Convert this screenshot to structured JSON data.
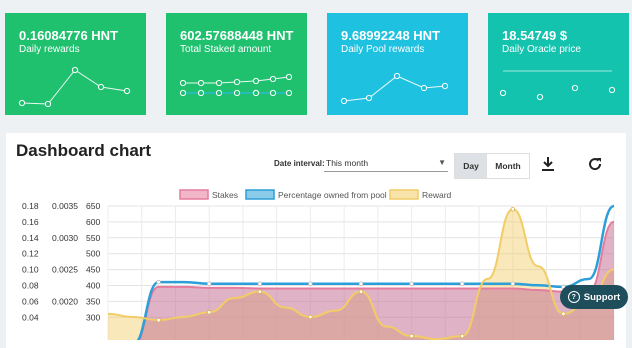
{
  "cards": [
    {
      "value": "0.16084776 HNT",
      "label": "Daily rewards",
      "color": "#1fc16f"
    },
    {
      "value": "602.57688448 HNT",
      "label": "Total Staked amount",
      "color": "#1fc16f"
    },
    {
      "value": "9.68992248 HNT",
      "label": "Daily Pool rewards",
      "color": "#1fc1e0"
    },
    {
      "value": "18.54749 $",
      "label": "Daily Oracle price",
      "color": "#14c3ad"
    }
  ],
  "panel": {
    "title": "Dashboard chart",
    "interval_label": "Date interval:",
    "interval_value": "This month",
    "day_label": "Day",
    "month_label": "Month",
    "support_label": "Support"
  },
  "chart_data": {
    "type": "area",
    "legend": [
      "Stakes",
      "Percentage owned from pool",
      "Reward"
    ],
    "legend_position": "top-center",
    "series_colors": [
      "#e67c9d",
      "#2d9fd8",
      "#f2cc66"
    ],
    "y_axes": [
      {
        "ticks": [
          "0.18",
          "0.16",
          "0.14",
          "0.12",
          "0.10",
          "0.08",
          "0.06",
          "0.04"
        ]
      },
      {
        "ticks": [
          "0.0035",
          "",
          "0.0030",
          "",
          "0.0025",
          "",
          "0.0020",
          ""
        ]
      },
      {
        "ticks": [
          "650",
          "600",
          "550",
          "500",
          "450",
          "400",
          "350",
          "300"
        ]
      }
    ],
    "stakes": [
      170,
      210,
      395,
      395,
      392,
      392,
      390,
      390,
      390,
      390,
      390,
      390,
      390,
      390,
      390,
      390,
      390,
      385,
      380,
      380,
      600
    ],
    "pool_percentage": [
      170,
      215,
      410,
      410,
      405,
      405,
      405,
      405,
      405,
      405,
      405,
      405,
      405,
      405,
      405,
      405,
      405,
      400,
      395,
      420,
      650
    ],
    "reward_scaled": [
      310,
      300,
      290,
      300,
      315,
      360,
      380,
      330,
      300,
      320,
      380,
      270,
      240,
      230,
      240,
      420,
      640,
      460,
      310,
      350,
      450
    ],
    "grid": true
  }
}
